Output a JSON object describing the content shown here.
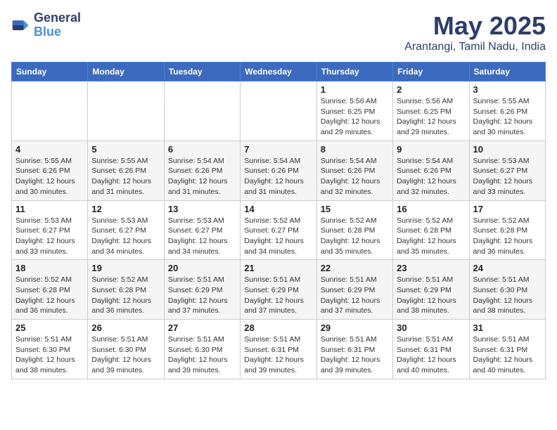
{
  "logo": {
    "text_general": "General",
    "text_blue": "Blue"
  },
  "title": "May 2025",
  "subtitle": "Arantangi, Tamil Nadu, India",
  "weekdays": [
    "Sunday",
    "Monday",
    "Tuesday",
    "Wednesday",
    "Thursday",
    "Friday",
    "Saturday"
  ],
  "weeks": [
    [
      {
        "day": "",
        "info": ""
      },
      {
        "day": "",
        "info": ""
      },
      {
        "day": "",
        "info": ""
      },
      {
        "day": "",
        "info": ""
      },
      {
        "day": "1",
        "info": "Sunrise: 5:56 AM\nSunset: 6:25 PM\nDaylight: 12 hours\nand 29 minutes."
      },
      {
        "day": "2",
        "info": "Sunrise: 5:56 AM\nSunset: 6:25 PM\nDaylight: 12 hours\nand 29 minutes."
      },
      {
        "day": "3",
        "info": "Sunrise: 5:55 AM\nSunset: 6:26 PM\nDaylight: 12 hours\nand 30 minutes."
      }
    ],
    [
      {
        "day": "4",
        "info": "Sunrise: 5:55 AM\nSunset: 6:26 PM\nDaylight: 12 hours\nand 30 minutes."
      },
      {
        "day": "5",
        "info": "Sunrise: 5:55 AM\nSunset: 6:26 PM\nDaylight: 12 hours\nand 31 minutes."
      },
      {
        "day": "6",
        "info": "Sunrise: 5:54 AM\nSunset: 6:26 PM\nDaylight: 12 hours\nand 31 minutes."
      },
      {
        "day": "7",
        "info": "Sunrise: 5:54 AM\nSunset: 6:26 PM\nDaylight: 12 hours\nand 31 minutes."
      },
      {
        "day": "8",
        "info": "Sunrise: 5:54 AM\nSunset: 6:26 PM\nDaylight: 12 hours\nand 32 minutes."
      },
      {
        "day": "9",
        "info": "Sunrise: 5:54 AM\nSunset: 6:26 PM\nDaylight: 12 hours\nand 32 minutes."
      },
      {
        "day": "10",
        "info": "Sunrise: 5:53 AM\nSunset: 6:27 PM\nDaylight: 12 hours\nand 33 minutes."
      }
    ],
    [
      {
        "day": "11",
        "info": "Sunrise: 5:53 AM\nSunset: 6:27 PM\nDaylight: 12 hours\nand 33 minutes."
      },
      {
        "day": "12",
        "info": "Sunrise: 5:53 AM\nSunset: 6:27 PM\nDaylight: 12 hours\nand 34 minutes."
      },
      {
        "day": "13",
        "info": "Sunrise: 5:53 AM\nSunset: 6:27 PM\nDaylight: 12 hours\nand 34 minutes."
      },
      {
        "day": "14",
        "info": "Sunrise: 5:52 AM\nSunset: 6:27 PM\nDaylight: 12 hours\nand 34 minutes."
      },
      {
        "day": "15",
        "info": "Sunrise: 5:52 AM\nSunset: 6:28 PM\nDaylight: 12 hours\nand 35 minutes."
      },
      {
        "day": "16",
        "info": "Sunrise: 5:52 AM\nSunset: 6:28 PM\nDaylight: 12 hours\nand 35 minutes."
      },
      {
        "day": "17",
        "info": "Sunrise: 5:52 AM\nSunset: 6:28 PM\nDaylight: 12 hours\nand 36 minutes."
      }
    ],
    [
      {
        "day": "18",
        "info": "Sunrise: 5:52 AM\nSunset: 6:28 PM\nDaylight: 12 hours\nand 36 minutes."
      },
      {
        "day": "19",
        "info": "Sunrise: 5:52 AM\nSunset: 6:28 PM\nDaylight: 12 hours\nand 36 minutes."
      },
      {
        "day": "20",
        "info": "Sunrise: 5:51 AM\nSunset: 6:29 PM\nDaylight: 12 hours\nand 37 minutes."
      },
      {
        "day": "21",
        "info": "Sunrise: 5:51 AM\nSunset: 6:29 PM\nDaylight: 12 hours\nand 37 minutes."
      },
      {
        "day": "22",
        "info": "Sunrise: 5:51 AM\nSunset: 6:29 PM\nDaylight: 12 hours\nand 37 minutes."
      },
      {
        "day": "23",
        "info": "Sunrise: 5:51 AM\nSunset: 6:29 PM\nDaylight: 12 hours\nand 38 minutes."
      },
      {
        "day": "24",
        "info": "Sunrise: 5:51 AM\nSunset: 6:30 PM\nDaylight: 12 hours\nand 38 minutes."
      }
    ],
    [
      {
        "day": "25",
        "info": "Sunrise: 5:51 AM\nSunset: 6:30 PM\nDaylight: 12 hours\nand 38 minutes."
      },
      {
        "day": "26",
        "info": "Sunrise: 5:51 AM\nSunset: 6:30 PM\nDaylight: 12 hours\nand 39 minutes."
      },
      {
        "day": "27",
        "info": "Sunrise: 5:51 AM\nSunset: 6:30 PM\nDaylight: 12 hours\nand 39 minutes."
      },
      {
        "day": "28",
        "info": "Sunrise: 5:51 AM\nSunset: 6:31 PM\nDaylight: 12 hours\nand 39 minutes."
      },
      {
        "day": "29",
        "info": "Sunrise: 5:51 AM\nSunset: 6:31 PM\nDaylight: 12 hours\nand 39 minutes."
      },
      {
        "day": "30",
        "info": "Sunrise: 5:51 AM\nSunset: 6:31 PM\nDaylight: 12 hours\nand 40 minutes."
      },
      {
        "day": "31",
        "info": "Sunrise: 5:51 AM\nSunset: 6:31 PM\nDaylight: 12 hours\nand 40 minutes."
      }
    ]
  ]
}
